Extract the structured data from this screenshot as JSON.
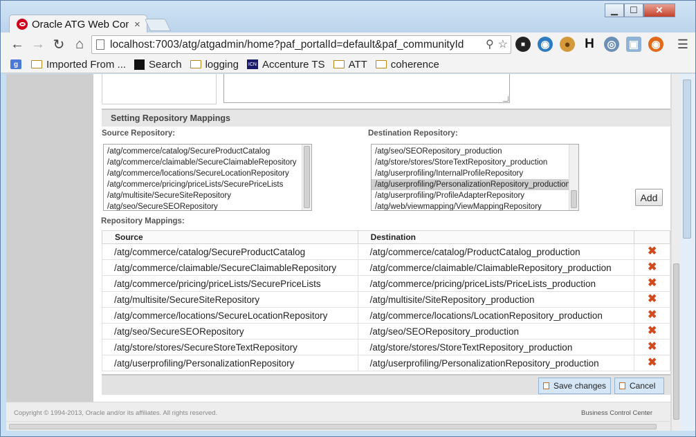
{
  "browser": {
    "tab_title": "Oracle ATG Web Commerce",
    "tab_close": "×",
    "url": "localhost:7003/atg/atgadmin/home?paf_portalId=default&paf_communityId",
    "window_controls": {
      "minimize": "▁",
      "maximize": "☐",
      "close": "✕"
    },
    "bookmarks": [
      {
        "label": "Imported From ...",
        "icon": "folder-icon"
      },
      {
        "label": "Search",
        "icon": "black-square-icon"
      },
      {
        "label": "logging",
        "icon": "folder-icon"
      },
      {
        "label": "Accenture TS",
        "icon": "accenture-icon"
      },
      {
        "label": "ATT",
        "icon": "folder-icon"
      },
      {
        "label": "coherence",
        "icon": "folder-icon"
      }
    ]
  },
  "panel": {
    "section_title": "Setting Repository Mappings",
    "source_label": "Source Repository:",
    "destination_label": "Destination Repository:",
    "source_options": [
      "/atg/commerce/catalog/SecureProductCatalog",
      "/atg/commerce/claimable/SecureClaimableRepository",
      "/atg/commerce/locations/SecureLocationRepository",
      "/atg/commerce/pricing/priceLists/SecurePriceLists",
      "/atg/multisite/SecureSiteRepository",
      "/atg/seo/SecureSEORepository"
    ],
    "destination_options": [
      "/atg/seo/SEORepository_production",
      "/atg/store/stores/StoreTextRepository_production",
      "/atg/userprofiling/InternalProfileRepository",
      "/atg/userprofiling/PersonalizationRepository_production",
      "/atg/userprofiling/ProfileAdapterRepository",
      "/atg/web/viewmapping/ViewMappingRepository"
    ],
    "add_label": "Add",
    "mappings_label": "Repository Mappings:",
    "col_source": "Source",
    "col_destination": "Destination",
    "mappings": [
      {
        "source": "/atg/commerce/catalog/SecureProductCatalog",
        "destination": "/atg/commerce/catalog/ProductCatalog_production"
      },
      {
        "source": "/atg/commerce/claimable/SecureClaimableRepository",
        "destination": "/atg/commerce/claimable/ClaimableRepository_production"
      },
      {
        "source": "/atg/commerce/pricing/priceLists/SecurePriceLists",
        "destination": "/atg/commerce/pricing/priceLists/PriceLists_production"
      },
      {
        "source": "/atg/multisite/SecureSiteRepository",
        "destination": "/atg/multisite/SiteRepository_production"
      },
      {
        "source": "/atg/commerce/locations/SecureLocationRepository",
        "destination": "/atg/commerce/locations/LocationRepository_production"
      },
      {
        "source": "/atg/seo/SecureSEORepository",
        "destination": "/atg/seo/SEORepository_production"
      },
      {
        "source": "/atg/store/stores/SecureStoreTextRepository",
        "destination": "/atg/store/stores/StoreTextRepository_production"
      },
      {
        "source": "/atg/userprofiling/PersonalizationRepository",
        "destination": "/atg/userprofiling/PersonalizationRepository_production"
      }
    ],
    "delete_glyph": "✖",
    "save_label": "Save changes",
    "cancel_label": "Cancel"
  },
  "footer": {
    "copyright": "Copyright © 1994-2013, Oracle and/or its affiliates. All rights reserved.",
    "product": "Business Control Center"
  },
  "colors": {
    "delete": "#d34a1e",
    "oracle_red": "#d0021b",
    "action_button": "#d5e6f6"
  }
}
